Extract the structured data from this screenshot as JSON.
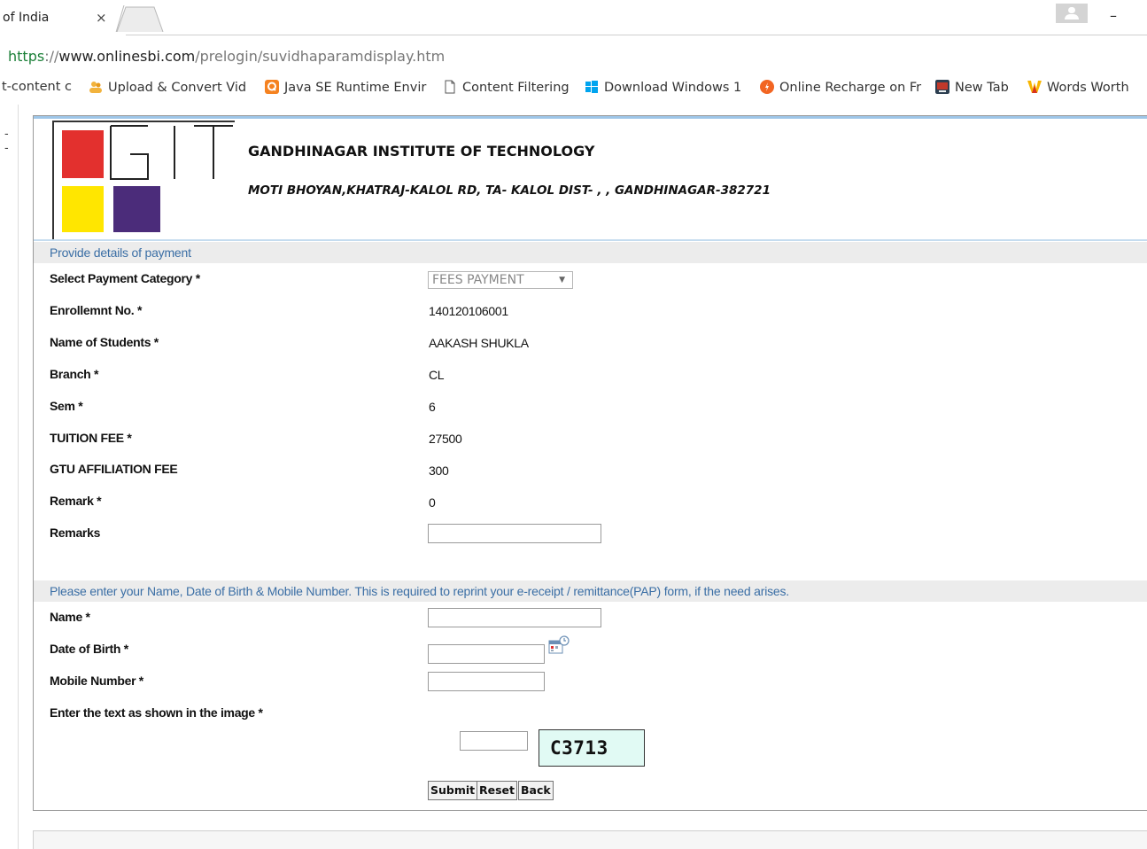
{
  "browser": {
    "tab_title": "of India",
    "tab_close": "×",
    "minimize_glyph": "–",
    "url": {
      "scheme": "https",
      "rest_pre": "://",
      "host": "www.onlinesbi.com",
      "path": "/prelogin/suvidhaparamdisplay.htm"
    },
    "bookmarks": [
      {
        "label": "t-content c",
        "icon": "none",
        "color": "#ffffff"
      },
      {
        "label": "Upload & Convert Vid",
        "icon": "people-icon",
        "color": "#f2b33d"
      },
      {
        "label": "Java SE Runtime Envir",
        "icon": "q-icon",
        "color": "#f58220"
      },
      {
        "label": "Content Filtering",
        "icon": "page-icon",
        "color": "#ffffff"
      },
      {
        "label": "Download Windows 1",
        "icon": "windows-icon",
        "color": "#00a4ef"
      },
      {
        "label": "Online Recharge on Fr",
        "icon": "freecharge-icon",
        "color": "#f26522"
      },
      {
        "label": "New Tab",
        "icon": "newtab-icon",
        "color": "#c0392b"
      },
      {
        "label": "Words Worth",
        "icon": "w-icon",
        "color": "#f7b500"
      }
    ],
    "gutter_text": "- -"
  },
  "header": {
    "institute_name": "GANDHINAGAR INSTITUTE OF TECHNOLOGY",
    "institute_address": "MOTI BHOYAN,KHATRAJ-KALOL RD, TA- KALOL DIST- , , GANDHINAGAR-382721",
    "logo_colors": {
      "red": "#e3302e",
      "yellow": "#ffe600",
      "purple": "#4b2c7a"
    }
  },
  "payment_section": {
    "title": "Provide details of payment",
    "fields": [
      {
        "label": "Select Payment Category *",
        "value": "FEES PAYMENT",
        "kind": "select"
      },
      {
        "label": "Enrollemnt No. *",
        "value": "140120106001"
      },
      {
        "label": "Name of Students *",
        "value": "AAKASH SHUKLA"
      },
      {
        "label": "Branch *",
        "value": "CL"
      },
      {
        "label": "Sem *",
        "value": "6"
      },
      {
        "label": "TUITION FEE *",
        "value": "27500"
      },
      {
        "label": "GTU AFFILIATION FEE",
        "value": "300"
      },
      {
        "label": "Remark *",
        "value": "0"
      },
      {
        "label": "Remarks",
        "value": ""
      }
    ]
  },
  "personal_section": {
    "title": "Please enter your Name, Date of Birth & Mobile Number. This is required to reprint your e-receipt / remittance(PAP) form, if the need arises.",
    "name_label": "Name *",
    "name_value": "",
    "dob_label": "Date of Birth *",
    "dob_value": "",
    "mobile_label": "Mobile Number *",
    "mobile_value": "",
    "captcha_label": "Enter the text as shown in the image *",
    "captcha_input": "",
    "captcha_text": "C3713"
  },
  "buttons": {
    "submit": "Submit",
    "reset": "Reset",
    "back": "Back"
  }
}
